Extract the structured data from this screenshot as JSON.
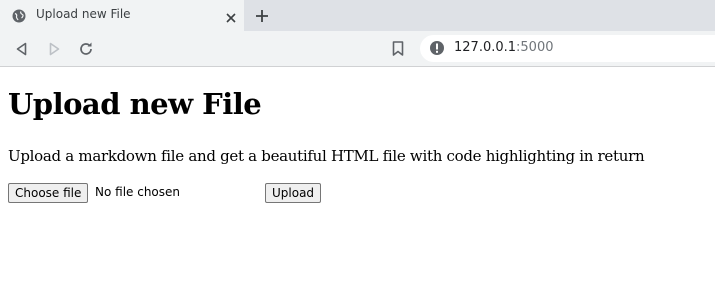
{
  "browser": {
    "tab": {
      "title": "Upload new File",
      "favicon": "globe-icon",
      "close_icon": "close-icon"
    },
    "new_tab_icon": "plus-icon",
    "toolbar": {
      "back_icon": "back-arrow-icon",
      "forward_icon": "forward-arrow-icon",
      "reload_icon": "reload-icon",
      "bookmark_icon": "bookmark-icon",
      "site_info_icon": "info-icon",
      "url_host": "127.0.0.1",
      "url_port": ":5000"
    }
  },
  "page": {
    "heading": "Upload new File",
    "description": "Upload a markdown file and get a beautiful HTML file with code highlighting in return",
    "form": {
      "choose_file_label": "Choose file",
      "file_status": "No file chosen",
      "upload_label": "Upload"
    }
  },
  "colors": {
    "tabstrip_bg": "#dee1e6",
    "toolbar_bg": "#f1f3f4",
    "button_bg": "#efefef",
    "button_border": "#767676"
  }
}
